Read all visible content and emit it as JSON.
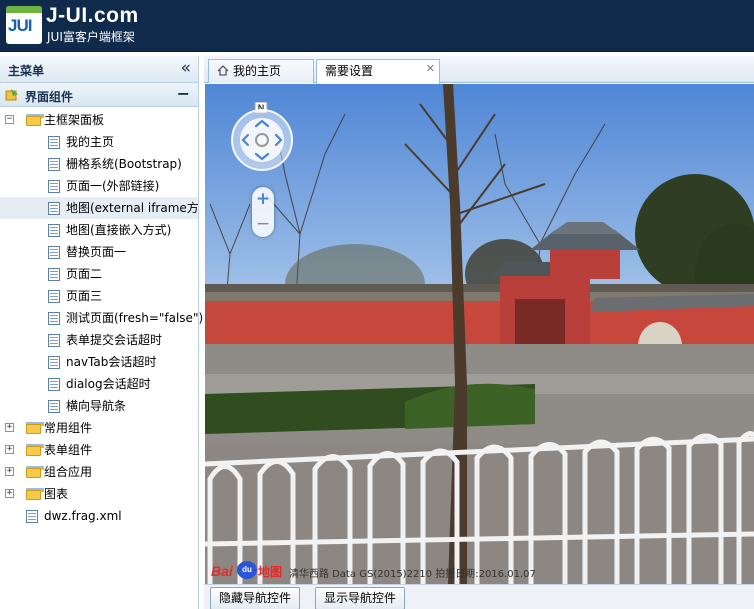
{
  "header": {
    "logo_badge": "JUI",
    "title": "J-UI.com",
    "subtitle": "JUI富客户端框架"
  },
  "sidebar": {
    "title": "主菜单",
    "section_title": "界面组件",
    "tree": [
      {
        "label": "主框架面板",
        "type": "folder",
        "expanded": true
      },
      {
        "label": "我的主页",
        "type": "page"
      },
      {
        "label": "栅格系统(Bootstrap)",
        "type": "page"
      },
      {
        "label": "页面一(外部链接)",
        "type": "page"
      },
      {
        "label": "地图(external iframe方",
        "type": "page",
        "selected": true
      },
      {
        "label": "地图(直接嵌入方式)",
        "type": "page"
      },
      {
        "label": "替换页面一",
        "type": "page"
      },
      {
        "label": "页面二",
        "type": "page"
      },
      {
        "label": "页面三",
        "type": "page"
      },
      {
        "label": "测试页面(fresh=\"false\")",
        "type": "page"
      },
      {
        "label": "表单提交会话超时",
        "type": "page"
      },
      {
        "label": "navTab会话超时",
        "type": "page"
      },
      {
        "label": "dialog会话超时",
        "type": "page"
      },
      {
        "label": "横向导航条",
        "type": "page"
      },
      {
        "label": "常用组件",
        "type": "folder",
        "expanded": false
      },
      {
        "label": "表单组件",
        "type": "folder",
        "expanded": false
      },
      {
        "label": "组合应用",
        "type": "folder",
        "expanded": false
      },
      {
        "label": "图表",
        "type": "folder",
        "expanded": false
      },
      {
        "label": "dwz.frag.xml",
        "type": "page"
      }
    ]
  },
  "tabs": [
    {
      "label": "我的主页",
      "icon": "home-icon",
      "active": false
    },
    {
      "label": "需要设置",
      "active": true,
      "closable": true
    }
  ],
  "map": {
    "compass_label": "N",
    "brand_bai": "Bai",
    "brand_du": "du",
    "brand_ditu": "地图",
    "copyright": "清华西路 Data   GS(2015)2210 拍摄日期:2016.01.07"
  },
  "buttons": {
    "hide_nav": "隐藏导航控件",
    "show_nav": "显示导航控件"
  },
  "colors": {
    "header_bg": "#102a4c",
    "accent": "#99bbe8"
  }
}
